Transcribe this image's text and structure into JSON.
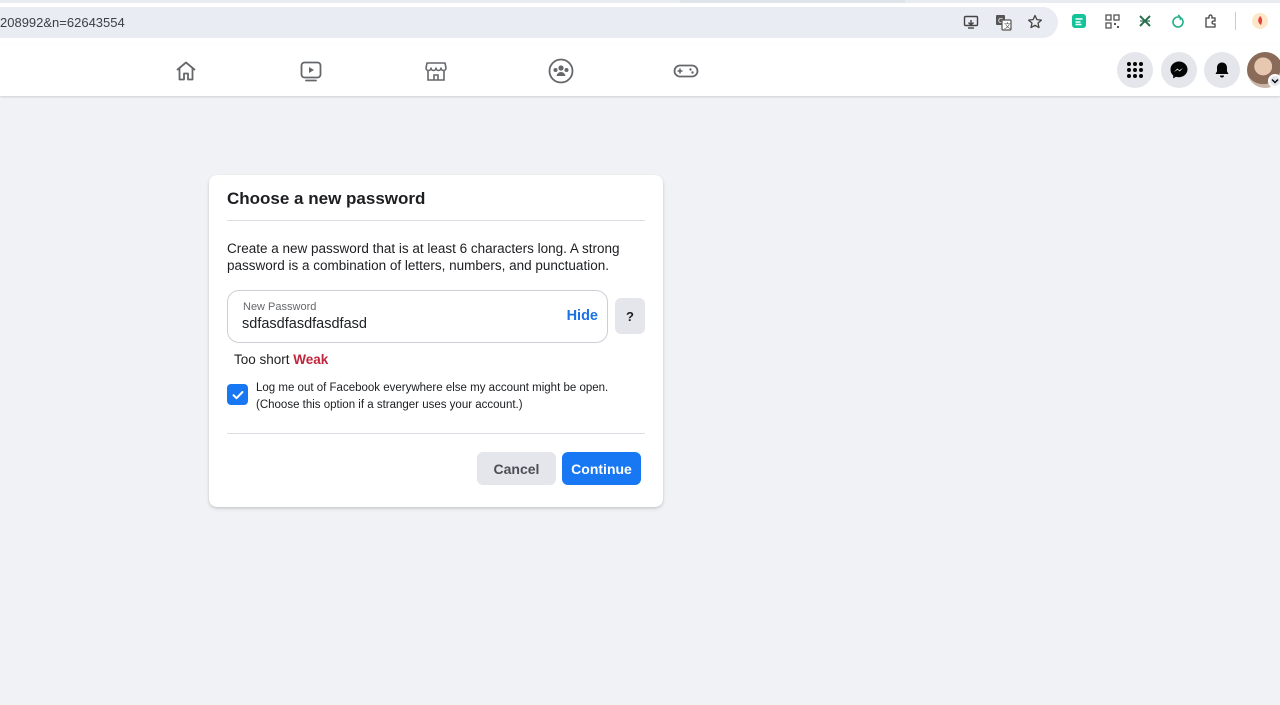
{
  "browser": {
    "url_fragment": "208992&n=62643554",
    "omnibox_icons": [
      "cast-icon",
      "translate-icon",
      "bookmark-star-icon"
    ],
    "extension_icons": [
      "grammar-extension-icon",
      "qr-code-icon",
      "extension-x-icon",
      "extension-leaf-icon",
      "puzzle-extensions-icon",
      "profile-extension-icon"
    ]
  },
  "nav": {
    "tabs": [
      "home",
      "watch",
      "marketplace",
      "groups",
      "gaming"
    ],
    "right_buttons": [
      "menu",
      "messenger",
      "notifications",
      "account"
    ]
  },
  "dialog": {
    "title": "Choose a new password",
    "description": "Create a new password that is at least 6 characters long. A strong password is a combination of letters, numbers, and punctuation.",
    "password_label": "New Password",
    "password_value": "sdfasdfasdfasdfasd",
    "hide_label": "Hide",
    "help_label": "?",
    "strength_prefix": "Too short",
    "strength_level": "Weak",
    "logout_checked": true,
    "logout_line1": "Log me out of Facebook everywhere else my account might be open.",
    "logout_line2": "(Choose this option if a stranger uses your account.)",
    "cancel_label": "Cancel",
    "continue_label": "Continue"
  },
  "colors": {
    "accent": "#1877f2",
    "weak": "#c0253b",
    "background": "#f0f2f5"
  }
}
